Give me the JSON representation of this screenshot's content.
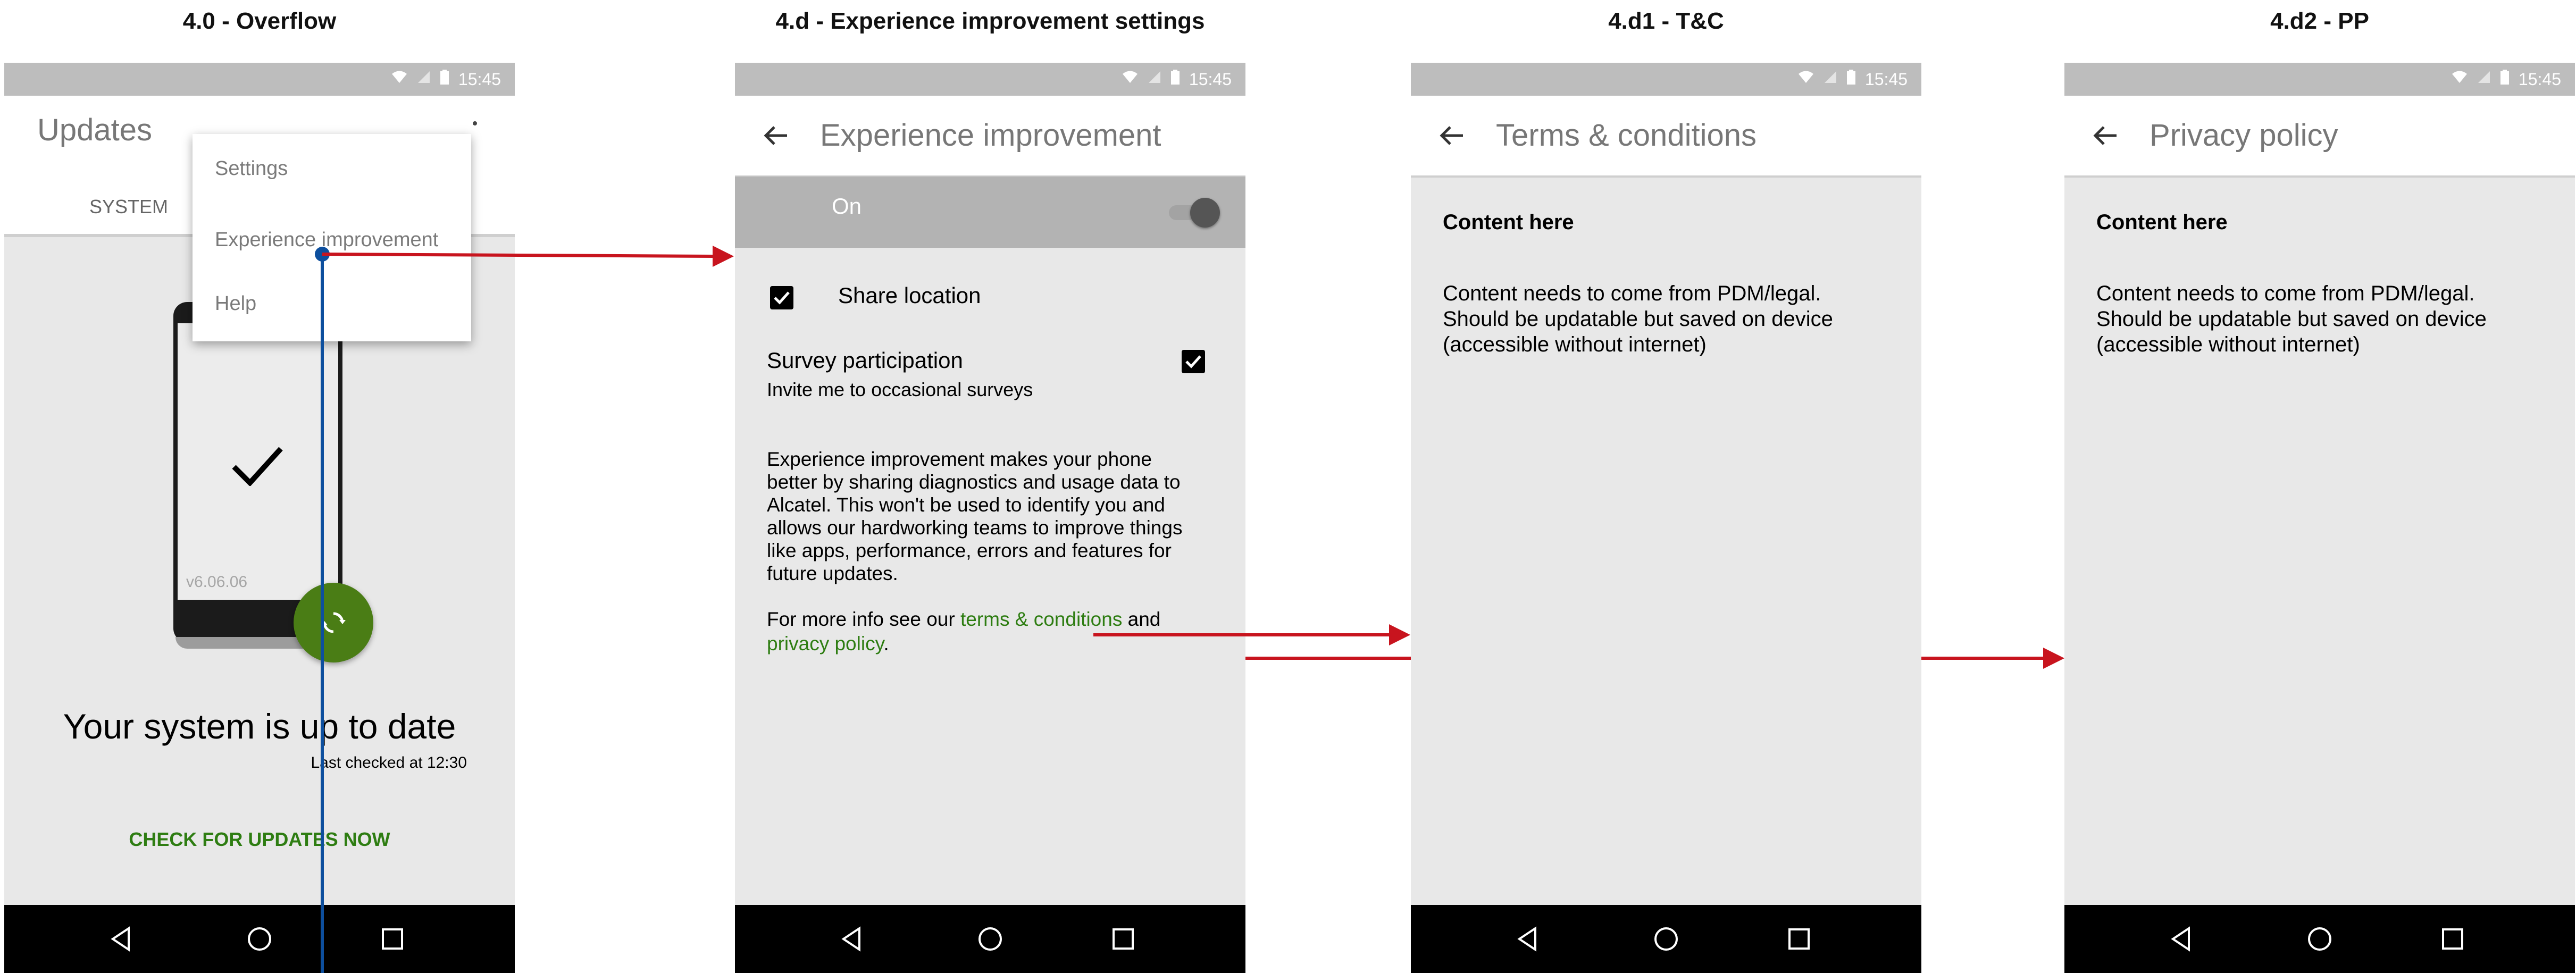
{
  "screens": [
    {
      "title": "4.0 - Overflow"
    },
    {
      "title": "4.d - Experience improvement settings"
    },
    {
      "title": "4.d1 - T&C"
    },
    {
      "title": "4.d2 - PP"
    }
  ],
  "status_bar": {
    "time": "15:45"
  },
  "overflow": {
    "app_title": "Updates",
    "tab_label": "SYSTEM",
    "menu_items": [
      "Settings",
      "Experience improvement",
      "Help"
    ],
    "version": "v6.06.06",
    "status_title": "Your system is up to date",
    "last_checked": "Last checked at 12:30",
    "check_button": "CHECK FOR UPDATES NOW"
  },
  "experience": {
    "title": "Experience improvement",
    "toggle_label": "On",
    "share_location": "Share location",
    "survey_title": "Survey participation",
    "survey_subtitle": "Invite me to occasional surveys",
    "description_lines": [
      "Experience improvement makes your phone",
      "better by sharing diagnostics and usage data to",
      "Alcatel. This won't be used to identify you and",
      "allows our hardworking teams to improve things",
      "like apps, performance, errors and features for",
      "future updates."
    ],
    "more_info_prefix": "For more info see our ",
    "terms_link": "terms & conditions",
    "and_text": " and",
    "privacy_link": "privacy policy",
    "period": "."
  },
  "terms": {
    "title": "Terms & conditions",
    "content_heading": "Content here",
    "content_lines": [
      "Content needs to come from PDM/legal.",
      "Should be updatable but saved on device",
      "(accessible without internet)"
    ]
  },
  "privacy": {
    "title": "Privacy policy",
    "content_heading": "Content here",
    "content_lines": [
      "Content needs to come from PDM/legal.",
      "Should be updatable but saved on device",
      "(accessible without internet)"
    ]
  },
  "colors": {
    "accent_green": "#2e7d12",
    "fab_green": "#4a7d15",
    "flow_arrow_red": "#c8141e",
    "flow_line_blue": "#0d4f9e"
  }
}
